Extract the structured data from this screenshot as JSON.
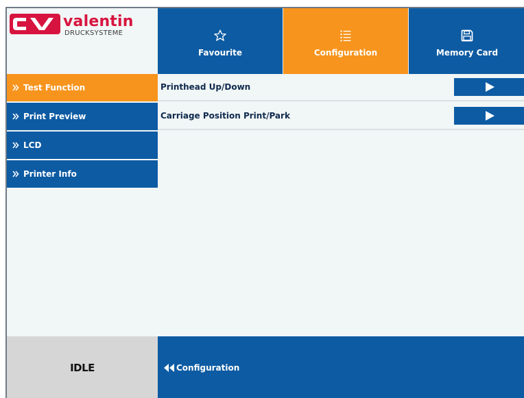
{
  "brand": {
    "name": "valentin",
    "subtitle": "DRUCKSYSTEME",
    "logo_mark": "CV",
    "color": "#d7143f"
  },
  "colors": {
    "primary": "#0d5ba3",
    "accent": "#f7941d",
    "status_bg": "#d6d6d6"
  },
  "top_tabs": [
    {
      "label": "Favourite",
      "icon": "star-icon",
      "active": false
    },
    {
      "label": "Configuration",
      "icon": "list-icon",
      "active": true
    },
    {
      "label": "Memory Card",
      "icon": "floppy-disk-icon",
      "active": false
    }
  ],
  "sidebar": {
    "items": [
      {
        "label": "Test Function",
        "active": true
      },
      {
        "label": "Print Preview",
        "active": false
      },
      {
        "label": "LCD",
        "active": false
      },
      {
        "label": "Printer Info",
        "active": false
      }
    ]
  },
  "content": {
    "rows": [
      {
        "label": "Printhead Up/Down",
        "action_icon": "play-icon"
      },
      {
        "label": "Carriage Position Print/Park",
        "action_icon": "play-icon"
      }
    ]
  },
  "status": {
    "text": "IDLE"
  },
  "breadcrumb": {
    "back_label": "Configuration",
    "icon": "double-left-arrow-icon"
  }
}
